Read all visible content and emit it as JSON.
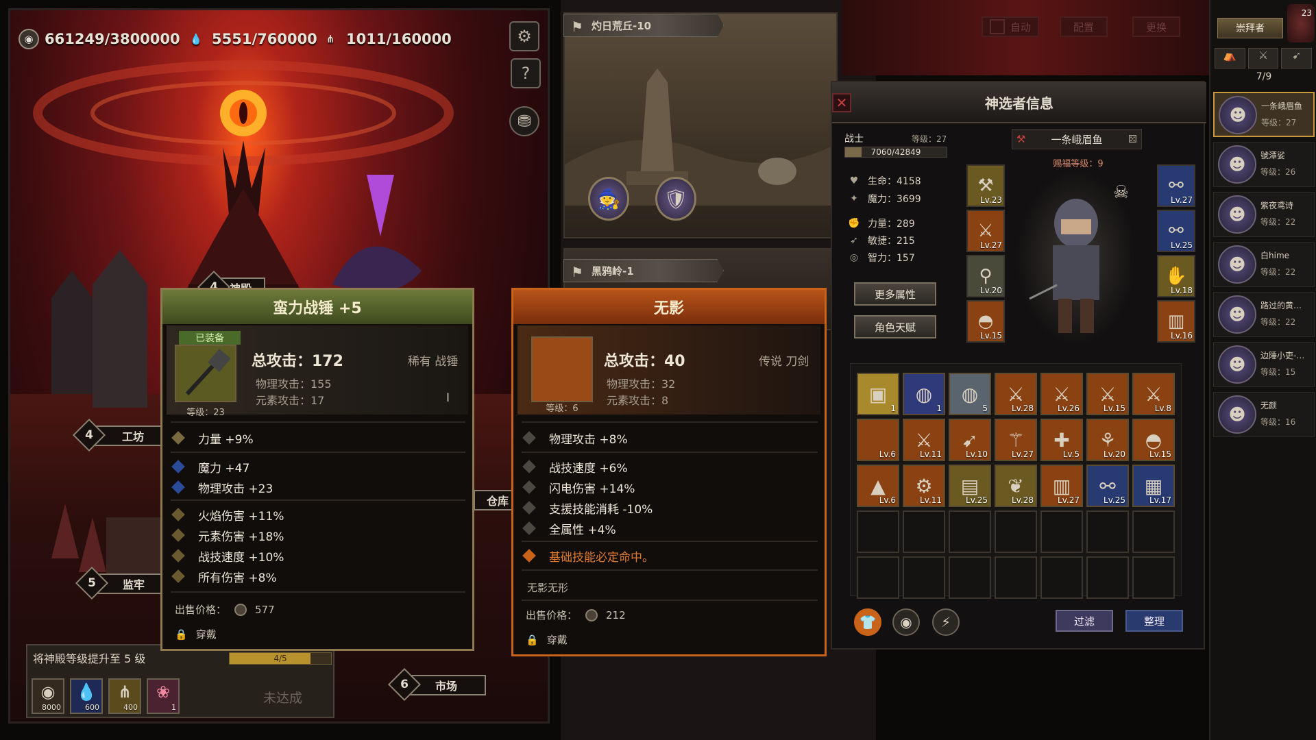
{
  "resources": [
    {
      "icon": "gold-coin-icon",
      "glyph": "◉",
      "value": "661249/3800000"
    },
    {
      "icon": "blood-drop-icon",
      "glyph": "💧",
      "value": "5551/760000"
    },
    {
      "icon": "wheat-icon",
      "glyph": "⋔",
      "value": "1011/160000"
    }
  ],
  "buildings": [
    {
      "num": "4",
      "label": "神殿"
    },
    {
      "num": "4",
      "label": "工坊"
    },
    {
      "num": "5",
      "label": "监牢"
    },
    {
      "num": "6",
      "label": "市场"
    },
    {
      "label": "仓库"
    }
  ],
  "quest": {
    "title": "将神殿等级提升至 5 级",
    "progress": "4/5",
    "progress_fraction": 0.8,
    "status": "未达成",
    "requirements": [
      {
        "icon": "gold-coin-icon",
        "glyph": "◉",
        "amount": "8000"
      },
      {
        "icon": "blood-drop-icon",
        "glyph": "💧",
        "amount": "600"
      },
      {
        "icon": "wheat-icon",
        "glyph": "⋔",
        "amount": "400"
      },
      {
        "icon": "flesh-icon",
        "glyph": "❀",
        "amount": "1"
      }
    ]
  },
  "stages": [
    {
      "name": "灼日荒丘-10"
    },
    {
      "name": "黑鸦岭-1"
    }
  ],
  "top_buttons": {
    "auto": "自动",
    "config": "配置",
    "replace": "更换"
  },
  "card_equipped": {
    "title": "蛮力战锤 +5",
    "badge": "已装备",
    "total_attack": "总攻击：172",
    "rarity": "稀有 战锤",
    "physical": "物理攻击：155",
    "elemental": "元素攻击：17",
    "level": "等级：23",
    "stats": [
      "力量 +9%",
      "魔力 +47",
      "物理攻击 +23",
      "火焰伤害 +11%",
      "元素伤害 +18%",
      "战技速度 +10%",
      "所有伤害 +8%"
    ],
    "price_label": "出售价格：",
    "price": "577",
    "equip_label": "穿戴"
  },
  "card_compare": {
    "title": "无影",
    "total_attack": "总攻击：40",
    "rarity": "传说 刀剑",
    "physical": "物理攻击：32",
    "elemental": "元素攻击：8",
    "level": "等级：6",
    "stats": [
      "物理攻击 +8%",
      "战技速度 +6%",
      "闪电伤害 +14%",
      "支援技能消耗 -10%",
      "全属性 +4%"
    ],
    "special": "基础技能必定命中。",
    "flavor": "无影无形",
    "price_label": "出售价格：",
    "price": "212",
    "equip_label": "穿戴"
  },
  "character": {
    "panel_title": "神选者信息",
    "class": "战士",
    "level": "等级：27",
    "exp": "7060/42849",
    "exp_fraction": 0.165,
    "name": "一条峨眉鱼",
    "blessing": "赐福等级：9",
    "attributes": [
      {
        "icon": "heart-icon",
        "glyph": "♥",
        "text": "生命：4158"
      },
      {
        "icon": "mana-icon",
        "glyph": "✦",
        "text": "魔力：3699"
      },
      {
        "icon": "fist-icon",
        "glyph": "✊",
        "text": "力量：289"
      },
      {
        "icon": "agility-icon",
        "glyph": "➶",
        "text": "敏捷：215"
      },
      {
        "icon": "eye-icon",
        "glyph": "◎",
        "text": "智力：157"
      }
    ],
    "more_attributes": "更多属性",
    "talent": "角色天赋",
    "equip_left": [
      "Lv.23",
      "Lv.27",
      "Lv.20",
      "Lv.15"
    ],
    "equip_right": [
      "Lv.27",
      "Lv.25",
      "Lv.18",
      "Lv.16"
    ]
  },
  "inventory": {
    "items": [
      {
        "label": "1",
        "glyph": "▣",
        "bg": "#a8892c"
      },
      {
        "label": "1",
        "glyph": "◍",
        "bg": "#2e3a7a"
      },
      {
        "label": "5",
        "glyph": "◍",
        "bg": "#5a646e"
      },
      {
        "label": "Lv.28",
        "glyph": "⚔",
        "bg": "#8a4212"
      },
      {
        "label": "Lv.26",
        "glyph": "⚔",
        "bg": "#8a4212"
      },
      {
        "label": "Lv.15",
        "glyph": "⚔",
        "bg": "#8a4212"
      },
      {
        "label": "Lv.8",
        "glyph": "⚔",
        "bg": "#8a4212"
      },
      {
        "label": "Lv.6",
        "glyph": "",
        "bg": "#8a4212"
      },
      {
        "label": "Lv.11",
        "glyph": "⚔",
        "bg": "#8a4212"
      },
      {
        "label": "Lv.10",
        "glyph": "➹",
        "bg": "#8a4212"
      },
      {
        "label": "Lv.27",
        "glyph": "⚚",
        "bg": "#8a4212"
      },
      {
        "label": "Lv.5",
        "glyph": "✚",
        "bg": "#8a4212"
      },
      {
        "label": "Lv.20",
        "glyph": "⚘",
        "bg": "#8a4212"
      },
      {
        "label": "Lv.15",
        "glyph": "◓",
        "bg": "#8a4212"
      },
      {
        "label": "Lv.6",
        "glyph": "▲",
        "bg": "#8a4212"
      },
      {
        "label": "Lv.11",
        "glyph": "⚙",
        "bg": "#8a4212"
      },
      {
        "label": "Lv.25",
        "glyph": "▤",
        "bg": "#6a5a22"
      },
      {
        "label": "Lv.28",
        "glyph": "❦",
        "bg": "#6a5a22"
      },
      {
        "label": "Lv.27",
        "glyph": "▥",
        "bg": "#8a4212"
      },
      {
        "label": "Lv.25",
        "glyph": "⚯",
        "bg": "#283a72"
      },
      {
        "label": "Lv.17",
        "glyph": "▦",
        "bg": "#283a72"
      }
    ],
    "filter": "过滤",
    "sort": "整理"
  },
  "roster": {
    "title": "崇拜者",
    "count": "7/9",
    "badge": "23",
    "members": [
      {
        "name": "一条峨眉鱼",
        "level": "等级：27"
      },
      {
        "name": "號潭娑",
        "level": "等级：26"
      },
      {
        "name": "紫夜鸢诗",
        "level": "等级：22"
      },
      {
        "name": "白hime",
        "level": "等级：22"
      },
      {
        "name": "路过的黄…",
        "level": "等级：22"
      },
      {
        "name": "边陲小吏-…",
        "level": "等级：15"
      },
      {
        "name": "无颜",
        "level": "等级：16"
      }
    ]
  },
  "colors": {
    "accent_gold": "#c89a3c",
    "legendary_orange": "#c9631a",
    "rare_green": "#6d7a3a",
    "special_text": "#e27a2a"
  }
}
